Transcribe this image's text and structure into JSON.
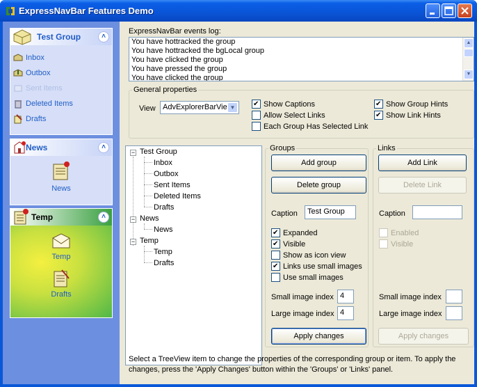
{
  "window": {
    "title": "ExpressNavBar Features Demo"
  },
  "navbar": {
    "groups": [
      {
        "caption": "Test Group",
        "icon": "folder-box-icon",
        "links": [
          {
            "label": "Inbox",
            "icon": "inbox-icon",
            "enabled": true
          },
          {
            "label": "Outbox",
            "icon": "outbox-icon",
            "enabled": true
          },
          {
            "label": "Sent Items",
            "icon": "sent-items-icon",
            "enabled": false
          },
          {
            "label": "Deleted Items",
            "icon": "deleted-items-icon",
            "enabled": true
          },
          {
            "label": "Drafts",
            "icon": "drafts-icon",
            "enabled": true
          }
        ]
      },
      {
        "caption": "News",
        "icon": "news-icon",
        "links": [
          {
            "label": "News",
            "icon": "news-large-icon"
          }
        ]
      },
      {
        "caption": "Temp",
        "icon": "temp-icon",
        "links": [
          {
            "label": "Temp",
            "icon": "envelope-icon"
          },
          {
            "label": "Drafts",
            "icon": "drafts-large-icon"
          }
        ]
      }
    ]
  },
  "events_log": {
    "label": "ExpressNavBar events log:",
    "lines": [
      "You have hottracked the  group",
      "You have hottracked the bgLocal group",
      "You have clicked the  group",
      "You have pressed the  group",
      "You have clicked the  group"
    ]
  },
  "general": {
    "legend": "General properties",
    "view_label": "View",
    "view_value": "AdvExplorerBarVie",
    "show_captions": "Show Captions",
    "allow_select_links": "Allow Select Links",
    "each_group_selected_link": "Each Group Has Selected Link",
    "show_group_hints": "Show Group Hints",
    "show_link_hints": "Show Link Hints"
  },
  "tree": {
    "nodes": [
      {
        "label": "Test Group",
        "children": [
          "Inbox",
          "Outbox",
          "Sent Items",
          "Deleted Items",
          "Drafts"
        ]
      },
      {
        "label": "News",
        "children": [
          "News"
        ]
      },
      {
        "label": "Temp",
        "children": [
          "Temp",
          "Drafts"
        ]
      }
    ]
  },
  "groups_panel": {
    "legend": "Groups",
    "add": "Add group",
    "delete": "Delete group",
    "caption_label": "Caption",
    "caption_value": "Test Group",
    "expanded": "Expanded",
    "visible": "Visible",
    "show_icon_view": "Show as icon view",
    "links_small": "Links use small images",
    "use_small": "Use small images",
    "small_index_label": "Small image index",
    "small_index_value": "4",
    "large_index_label": "Large image index",
    "large_index_value": "4",
    "apply": "Apply changes"
  },
  "links_panel": {
    "legend": "Links",
    "add": "Add Link",
    "delete": "Delete Link",
    "caption_label": "Caption",
    "caption_value": "",
    "enabled": "Enabled",
    "visible": "Visible",
    "small_index_label": "Small image index",
    "small_index_value": "",
    "large_index_label": "Large image index",
    "large_index_value": "",
    "apply": "Apply changes"
  },
  "hint": "Select a TreeView item to change the properties of the corresponding group or item. To apply the changes, press the 'Apply Changes' button within the 'Groups' or 'Links' panel."
}
